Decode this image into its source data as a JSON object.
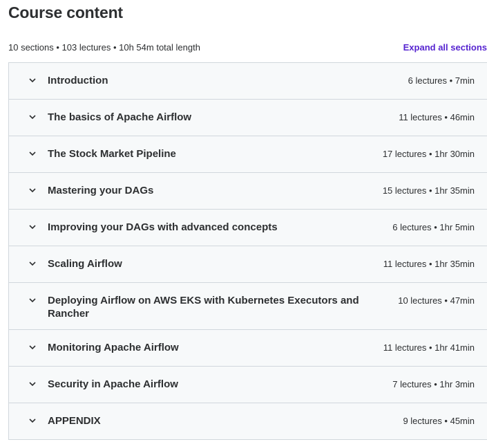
{
  "header": {
    "title": "Course content",
    "summary": "10 sections • 103 lectures • 10h 54m total length",
    "expand_all_label": "Expand all sections"
  },
  "sections": [
    {
      "title": "Introduction",
      "meta": "6 lectures • 7min"
    },
    {
      "title": "The basics of Apache Airflow",
      "meta": "11 lectures • 46min"
    },
    {
      "title": "The Stock Market Pipeline",
      "meta": "17 lectures • 1hr 30min"
    },
    {
      "title": "Mastering your DAGs",
      "meta": "15 lectures • 1hr 35min"
    },
    {
      "title": "Improving your DAGs with advanced concepts",
      "meta": "6 lectures • 1hr 5min"
    },
    {
      "title": "Scaling Airflow",
      "meta": "11 lectures • 1hr 35min"
    },
    {
      "title": "Deploying Airflow on AWS EKS with Kubernetes Executors and Rancher",
      "meta": "10 lectures • 47min"
    },
    {
      "title": "Monitoring Apache Airflow",
      "meta": "11 lectures • 1hr 41min"
    },
    {
      "title": "Security in Apache Airflow",
      "meta": "7 lectures • 1hr 3min"
    },
    {
      "title": "APPENDIX",
      "meta": "9 lectures • 45min"
    }
  ],
  "icons": {
    "section_toggle": "chevron-down-icon"
  },
  "colors": {
    "accent": "#5624d0",
    "text": "#2d2f31",
    "section_bg": "#f7f9fa",
    "border": "#d1d7dc"
  }
}
